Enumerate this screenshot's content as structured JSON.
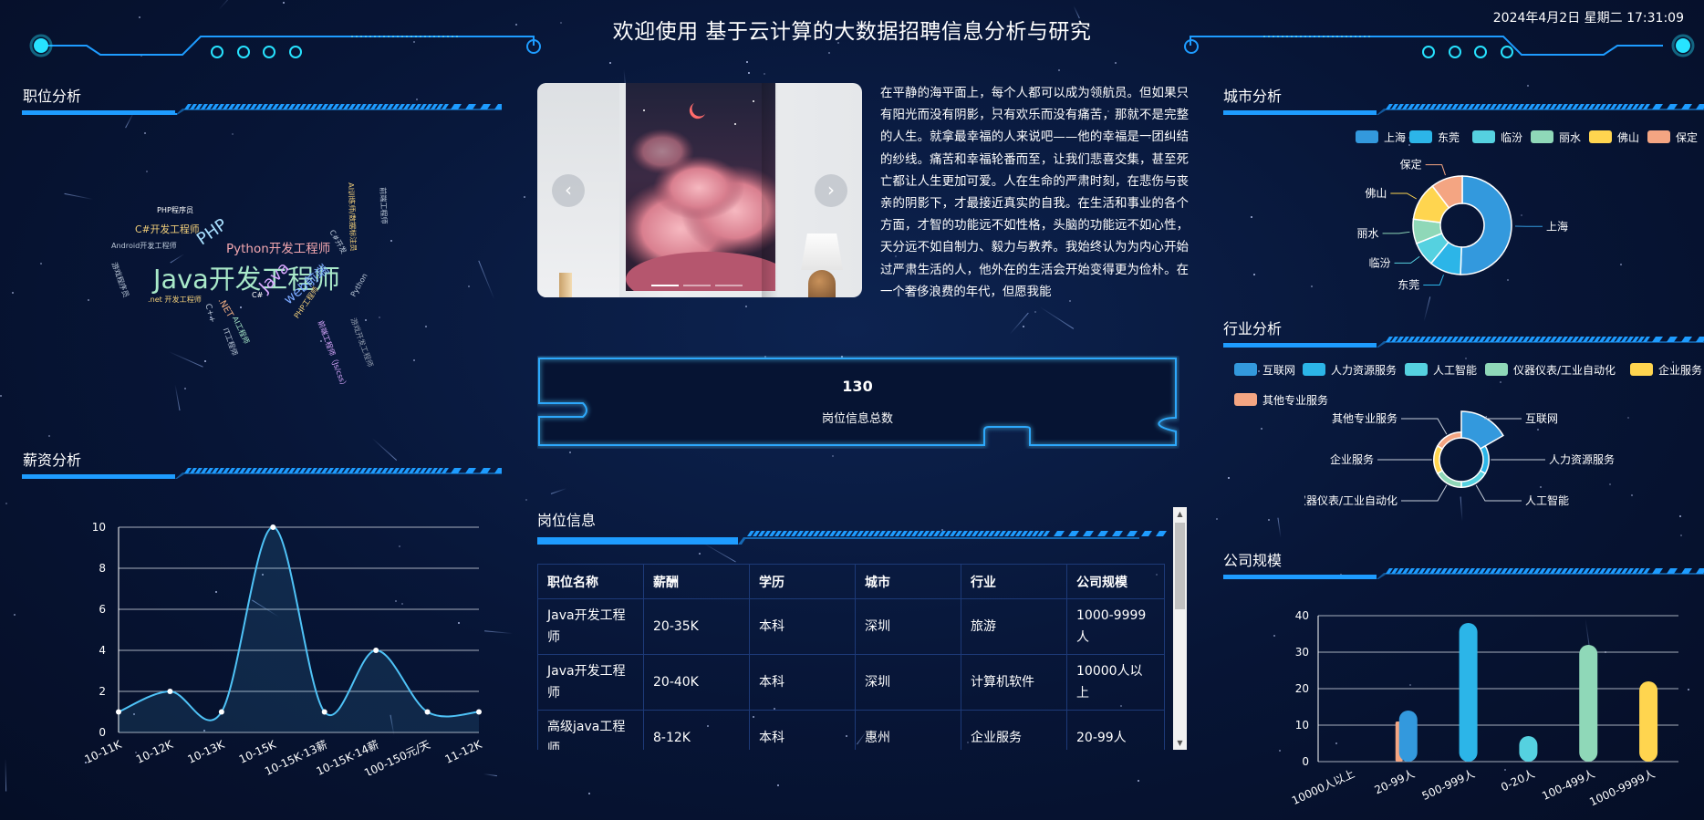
{
  "header": {
    "title": "欢迎使用 基于云计算的大数据招聘信息分析与研究",
    "datetime": "2024年4月2日 星期二 17:31:09"
  },
  "panels": {
    "position_analysis": "职位分析",
    "salary_analysis": "薪资分析",
    "job_info": "岗位信息",
    "city_analysis": "城市分析",
    "industry_analysis": "行业分析",
    "company_size": "公司规模"
  },
  "wordcloud": [
    {
      "text": "Java开发工程师",
      "color": "#a9e9c9",
      "size": 32
    },
    {
      "text": "Python开发工程师",
      "color": "#f4a8b0",
      "size": 15
    },
    {
      "text": "PHP",
      "color": "#a9e0ff",
      "size": 20
    },
    {
      "text": "C#开发工程师",
      "color": "#f3d07a",
      "size": 12
    },
    {
      "text": "PHP程序员",
      "color": "#ffffff",
      "size": 9
    },
    {
      "text": "Android开发工程师",
      "color": "#b9c6d6",
      "size": 9
    },
    {
      "text": "游戏程序员",
      "color": "#b9c6d6",
      "size": 9
    },
    {
      "text": ".net 开发工程师",
      "color": "#f3d07a",
      "size": 9
    },
    {
      "text": "Java",
      "color": "#d9a8ff",
      "size": 20
    },
    {
      "text": "web前端",
      "color": "#7aa8ff",
      "size": 16
    },
    {
      "text": "C#",
      "color": "#ffffff",
      "size": 9
    },
    {
      "text": ".NET",
      "color": "#f4b184",
      "size": 11
    },
    {
      "text": "C++",
      "color": "#b9c6d6",
      "size": 10
    },
    {
      "text": "AI工程师",
      "color": "#a9e9c9",
      "size": 9
    },
    {
      "text": "IT工程师",
      "color": "#b9c6d6",
      "size": 9
    },
    {
      "text": "PHP工程师",
      "color": "#f3d07a",
      "size": 9
    },
    {
      "text": "前端工程师（Js/css）",
      "color": "#d9a8ff",
      "size": 9
    },
    {
      "text": "Python",
      "color": "#b9c6d6",
      "size": 9
    },
    {
      "text": "游戏开发工程师",
      "color": "#8f9aab",
      "size": 9
    },
    {
      "text": "AI训练师/数据标注员",
      "color": "#f3d07a",
      "size": 9
    },
    {
      "text": "前端工程师",
      "color": "#b9c6d6",
      "size": 9
    },
    {
      "text": "C#开发",
      "color": "#b9c6d6",
      "size": 9
    }
  ],
  "carousel": {
    "prev_icon": "‹",
    "next_icon": "›"
  },
  "article": "在平静的海平面上，每个人都可以成为领航员。但如果只有阳光而没有阴影，只有欢乐而没有痛苦，那就不是完整的人生。就拿最幸福的人来说吧——他的幸福是一团纠结的纱线。痛苦和幸福轮番而至，让我们悲喜交集，甚至死亡都让人生更加可爱。人在生命的严肃时刻，在悲伤与丧亲的阴影下，才最接近真实的自我。在生活和事业的各个方面，才智的功能远不如性格，头脑的功能远不如心性，天分远不如自制力、毅力与教养。我始终认为为内心开始过严肃生活的人，他外在的生活会开始变得更为俭朴。在一个奢侈浪费的年代，但愿我能",
  "stats": {
    "total": "130",
    "total_label": "岗位信息总数"
  },
  "job_table": {
    "headers": [
      "职位名称",
      "薪酬",
      "学历",
      "城市",
      "行业",
      "公司规模"
    ],
    "rows": [
      [
        "Java开发工程师",
        "20-35K",
        "本科",
        "深圳",
        "旅游",
        "1000-9999人"
      ],
      [
        "Java开发工程师",
        "20-40K",
        "本科",
        "深圳",
        "计算机软件",
        "10000人以上"
      ],
      [
        "高级java工程师",
        "8-12K",
        "本科",
        "惠州",
        "企业服务",
        "20-99人"
      ]
    ]
  },
  "colors": {
    "accent": "#1e9cff",
    "line": "#4fc3f7",
    "c1": "#3399dd",
    "c2": "#2cb5e8",
    "c3": "#55d1e0",
    "c4": "#8fd8b8",
    "c5": "#ffd54f",
    "c6": "#f4a582"
  },
  "chart_data": [
    {
      "id": "salary",
      "type": "line",
      "categories": [
        "10-11K",
        "10-12K",
        "10-13K",
        "10-15K",
        "10-15K·13薪",
        "10-15K·14薪",
        "100-150元/天",
        "11-12K"
      ],
      "values": [
        1,
        2,
        1,
        10,
        1,
        4,
        1,
        1
      ],
      "ylim": [
        0,
        10
      ],
      "yticks": [
        0,
        2,
        4,
        6,
        8,
        10
      ],
      "smooth": true,
      "grid": true
    },
    {
      "id": "city",
      "type": "pie",
      "donut": true,
      "categories": [
        "上海",
        "东莞",
        "临汾",
        "丽水",
        "佛山",
        "保定"
      ],
      "values": [
        44,
        9,
        7,
        7,
        11,
        9
      ],
      "legend": "top-right"
    },
    {
      "id": "industry",
      "type": "pie",
      "rose": true,
      "categories": [
        "互联网",
        "人力资源服务",
        "人工智能",
        "仪器仪表/工业自动化",
        "企业服务",
        "其他专业服务"
      ],
      "values": [
        8,
        1,
        1,
        1,
        1,
        1
      ],
      "legend": "top"
    },
    {
      "id": "company",
      "type": "bar",
      "categories": [
        "10000人以上",
        "20-99人",
        "500-999人",
        "0-20人",
        "100-499人",
        "1000-9999人"
      ],
      "values": [
        11,
        14,
        38,
        7,
        32,
        22
      ],
      "ylim": [
        0,
        40
      ],
      "yticks": [
        0,
        10,
        20,
        30,
        40
      ],
      "grid": true
    }
  ]
}
